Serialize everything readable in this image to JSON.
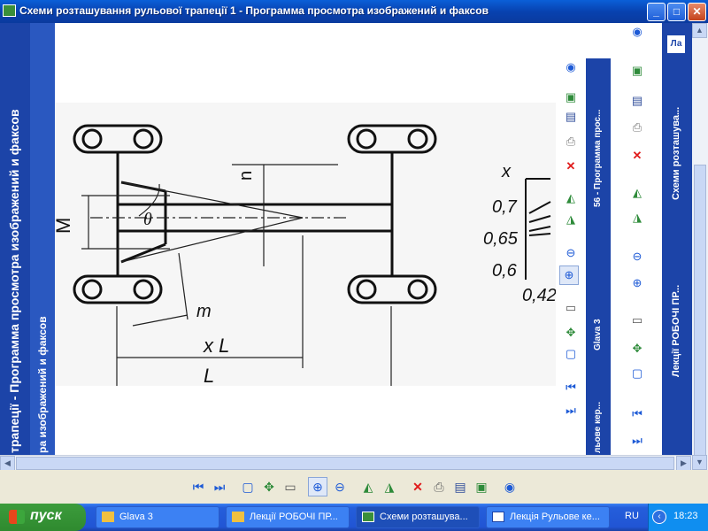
{
  "window": {
    "title": "Схеми розташування рульової трапеції 1 - Программа просмотра изображений и факсов",
    "controls": {
      "minimize": "_",
      "maximize": "□",
      "close": "✕"
    }
  },
  "drawing": {
    "labels": {
      "M": "M",
      "n": "n",
      "theta": "θ",
      "m": "m",
      "xL": "x L",
      "L": "L",
      "x": "x"
    },
    "chart_ticks": [
      "0,7",
      "0,65",
      "0,6",
      "0,42"
    ]
  },
  "stack": {
    "band1_text": "трапеції - Программа просмотра изображений и факсов",
    "band2_text": "ра изображений и факсов",
    "col2_label1": "56 - Программа прос...",
    "col2_label2": "Glava 3",
    "col2_label3": "льове кер...",
    "col3_label1": "Схеми розташува...",
    "col3_label2": "Лекції РОБОЧІ ПР...",
    "right_label": "Ла"
  },
  "taskbar": {
    "start_label": "пуск",
    "tasks": [
      {
        "label": "Glava 3"
      },
      {
        "label": "Лекції РОБОЧІ ПР..."
      },
      {
        "label": "Схеми розташува..."
      },
      {
        "label": "Лекція Рульове ке..."
      }
    ],
    "language": "RU",
    "clock": "18:23"
  }
}
